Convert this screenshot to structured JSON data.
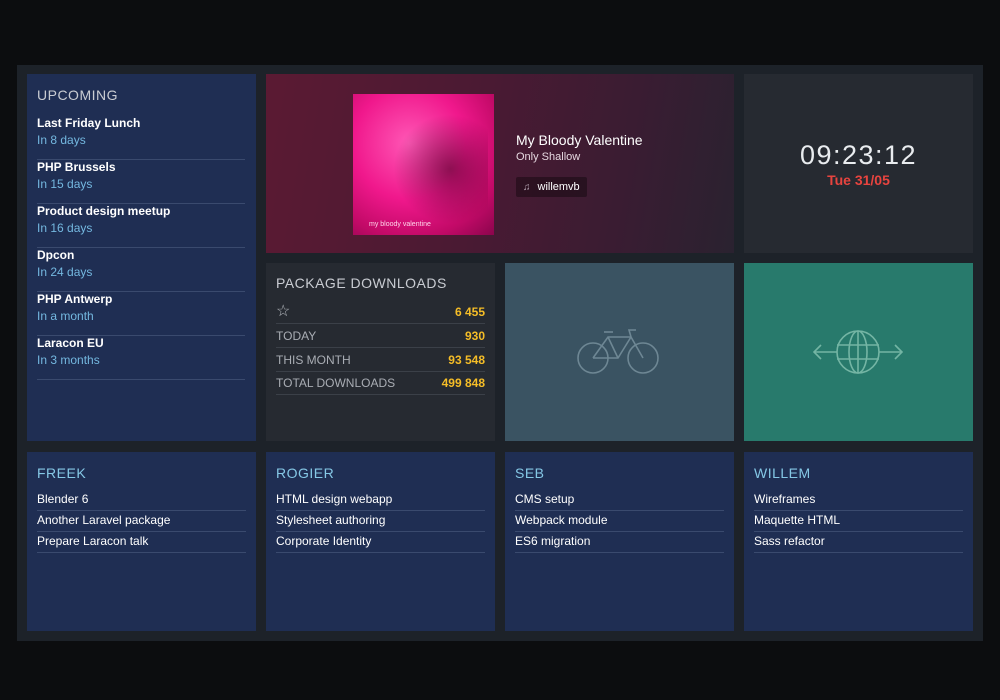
{
  "upcoming": {
    "title": "Upcoming",
    "events": [
      {
        "name": "Last Friday Lunch",
        "when": "In 8 days"
      },
      {
        "name": "PHP Brussels",
        "when": "In 15 days"
      },
      {
        "name": "Product design meetup",
        "when": "In 16 days"
      },
      {
        "name": "Dpcon",
        "when": "In 24 days"
      },
      {
        "name": "PHP Antwerp",
        "when": "In a month"
      },
      {
        "name": "Laracon EU",
        "when": "In 3 months"
      }
    ]
  },
  "music": {
    "cover_caption": "my bloody valentine",
    "artist": "My Bloody Valentine",
    "track": "Only Shallow",
    "user": "willemvb",
    "user_icon": "music-note-icon"
  },
  "clock": {
    "time": "09:23:12",
    "date": "Tue 31/05"
  },
  "packages": {
    "title": "Package Downloads",
    "stats": [
      {
        "label": "☆",
        "value": "6 455"
      },
      {
        "label": "Today",
        "value": "930"
      },
      {
        "label": "This month",
        "value": "93 548"
      },
      {
        "label": "Total downloads",
        "value": "499 848"
      }
    ]
  },
  "icons": {
    "bike": "bicycle-icon",
    "globe": "globe-arrows-icon"
  },
  "teams": [
    {
      "name": "Freek",
      "tasks": [
        "Blender 6",
        "Another Laravel package",
        "Prepare Laracon talk"
      ]
    },
    {
      "name": "Rogier",
      "tasks": [
        "HTML design webapp",
        "Stylesheet authoring",
        "Corporate Identity"
      ]
    },
    {
      "name": "Seb",
      "tasks": [
        "CMS setup",
        "Webpack module",
        "ES6 migration"
      ]
    },
    {
      "name": "Willem",
      "tasks": [
        "Wireframes",
        "Maquette HTML",
        "Sass refactor"
      ]
    }
  ],
  "colors": {
    "background": "#0c0d0f",
    "tile_blue": "#1f2e53",
    "tile_dark": "#262a31",
    "tile_slate": "#3a5362",
    "tile_teal": "#287a6c",
    "accent_blue": "#85c8e6",
    "accent_yellow": "#f5bd27",
    "accent_red": "#e8443f"
  }
}
